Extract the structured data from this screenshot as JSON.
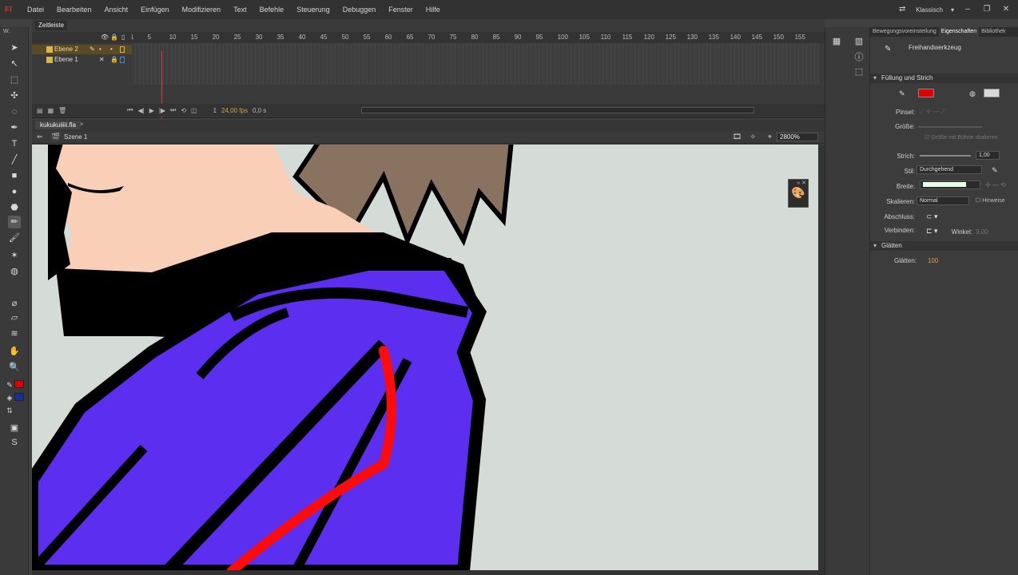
{
  "app": {
    "logo": "Fl",
    "workspace": "Klassisch"
  },
  "menu": [
    "Datei",
    "Bearbeiten",
    "Ansicht",
    "Einfügen",
    "Modifizieren",
    "Text",
    "Befehle",
    "Steuerung",
    "Debuggen",
    "Fenster",
    "Hilfe"
  ],
  "timeline": {
    "tab": "Zeitleiste",
    "layers": [
      {
        "name": "Ebene 2",
        "active": true
      },
      {
        "name": "Ebene 1",
        "active": false
      }
    ],
    "ruler": [
      "1",
      "5",
      "10",
      "15",
      "20",
      "25",
      "30",
      "35",
      "40",
      "45",
      "50",
      "55",
      "60",
      "65",
      "70",
      "75",
      "80",
      "85",
      "90",
      "95",
      "100",
      "105",
      "110",
      "115",
      "120",
      "125",
      "130",
      "135",
      "140",
      "145",
      "150",
      "155"
    ],
    "frame": "1",
    "fps": "24,00 fps",
    "time": "0,0 s"
  },
  "document": {
    "tab": "kukukuiiiii.fla",
    "close": "×",
    "scene": "Szene 1",
    "zoom": "2800%"
  },
  "props_panel": {
    "tabs": [
      "Bewegungsvoreinstellung",
      "Eigenschaften",
      "Bibliothek"
    ],
    "tool": "Freihandwerkzeug",
    "sections": {
      "fill": "Füllung und Strich",
      "smooth": "Glätten"
    },
    "labels": {
      "brush": "Pinsel:",
      "size": "Größe:",
      "stroke": "Strich:",
      "style": "Stil:",
      "width": "Breite:",
      "scale": "Skalieren:",
      "cap": "Abschluss:",
      "join": "Verbinden:",
      "angle": "Winkel:",
      "hints": "Hinweise",
      "smooth": "Glätten:"
    },
    "values": {
      "stroke": "1,00",
      "style": "Durchgehend",
      "scale": "Normal",
      "angle": "3,00",
      "smooth": "100"
    },
    "colors": {
      "stroke": "#e00000",
      "fill": "#d8d8d8",
      "width_preview": "#e8ffe8"
    }
  },
  "colors": {
    "accent": "#e03a3a",
    "layer_active": "#d9b64a",
    "fill_color": "#1a2d9c",
    "stroke_color": "#e00000"
  }
}
